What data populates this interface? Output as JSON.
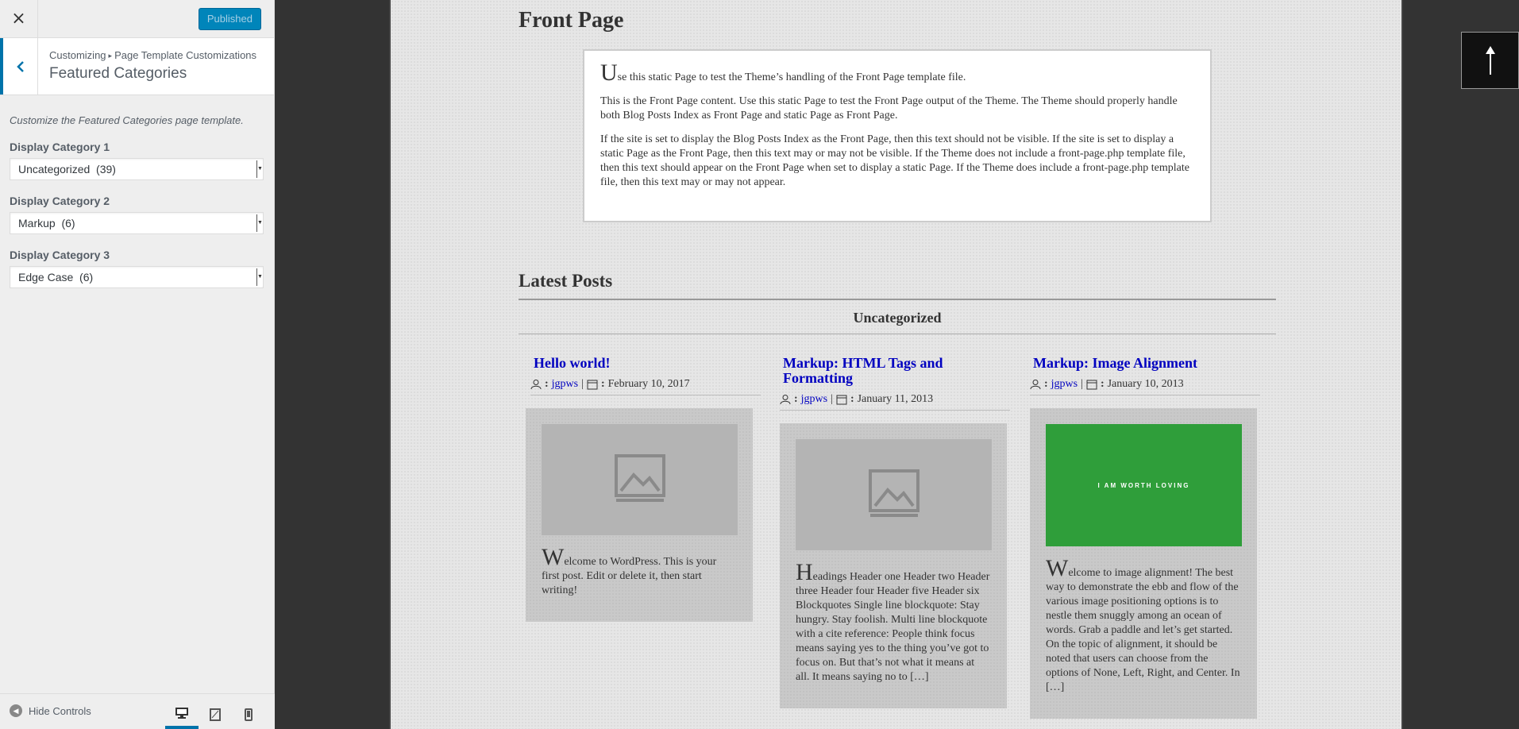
{
  "sidebar": {
    "close_glyph": "×",
    "publish_label": "Published",
    "breadcrumb": {
      "root": "Customizing",
      "sep": "▸",
      "parent": "Page Template Customizations"
    },
    "section_title": "Featured Categories",
    "description": "Customize the Featured Categories page template.",
    "controls": [
      {
        "label": "Display Category 1",
        "value": "Uncategorized  (39)"
      },
      {
        "label": "Display Category 2",
        "value": "Markup  (6)"
      },
      {
        "label": "Display Category 3",
        "value": "Edge Case  (6)"
      }
    ],
    "footer": {
      "hide_label": "Hide Controls"
    },
    "accent_color": "#0073aa"
  },
  "preview": {
    "page_title": "Front Page",
    "paragraphs": [
      {
        "drop": "U",
        "text": "se this static Page to test the Theme’s handling of the Front Page template file."
      },
      {
        "drop": "",
        "text": "This is the Front Page content. Use this static Page to test the Front Page output of the Theme. The Theme should properly handle both Blog Posts Index as Front Page and static Page as Front Page."
      },
      {
        "drop": "",
        "text": "If the site is set to display the Blog Posts Index as the Front Page, then this text should not be visible. If the site is set to display a static Page as the Front Page, then this text may or may not be visible. If the Theme does not include a front-page.php template file, then this text should appear on the Front Page when set to display a static Page. If the Theme does include a front-page.php template file, then this text may or may not appear."
      }
    ],
    "latest_title": "Latest Posts",
    "category_name": "Uncategorized",
    "posts": [
      {
        "title": "Hello world!",
        "author": "jgpws",
        "date": "February 10, 2017",
        "drop": "W",
        "excerpt": "elcome to WordPress. This is your first post. Edit or delete it, then start writing!"
      },
      {
        "title": "Markup: HTML Tags and Formatting",
        "author": "jgpws",
        "date": "January 11, 2013",
        "drop": "H",
        "excerpt": "eadings Header one Header two Header three Header four Header five Header six Blockquotes Single line blockquote: Stay hungry. Stay foolish. Multi line blockquote with a cite reference: People think focus means saying yes to the thing you’ve got to focus on. But that’s not what it means at all. It means saying no to […]"
      },
      {
        "title": "Markup: Image Alignment",
        "author": "jgpws",
        "date": "January 10, 2013",
        "drop": "W",
        "excerpt": "elcome to image alignment! The best way to demonstrate the ebb and flow of the various image positioning options is to nestle them snuggly among an ocean of words. Grab a paddle and let’s get started. On the topic of alignment, it should be noted that users can choose from the options of None, Left, Right, and Center. In […]",
        "image_text": "I AM WORTH LOVING"
      }
    ],
    "meta_sep": ":",
    "meta_bar": "|",
    "link_color": "#0000c0"
  }
}
